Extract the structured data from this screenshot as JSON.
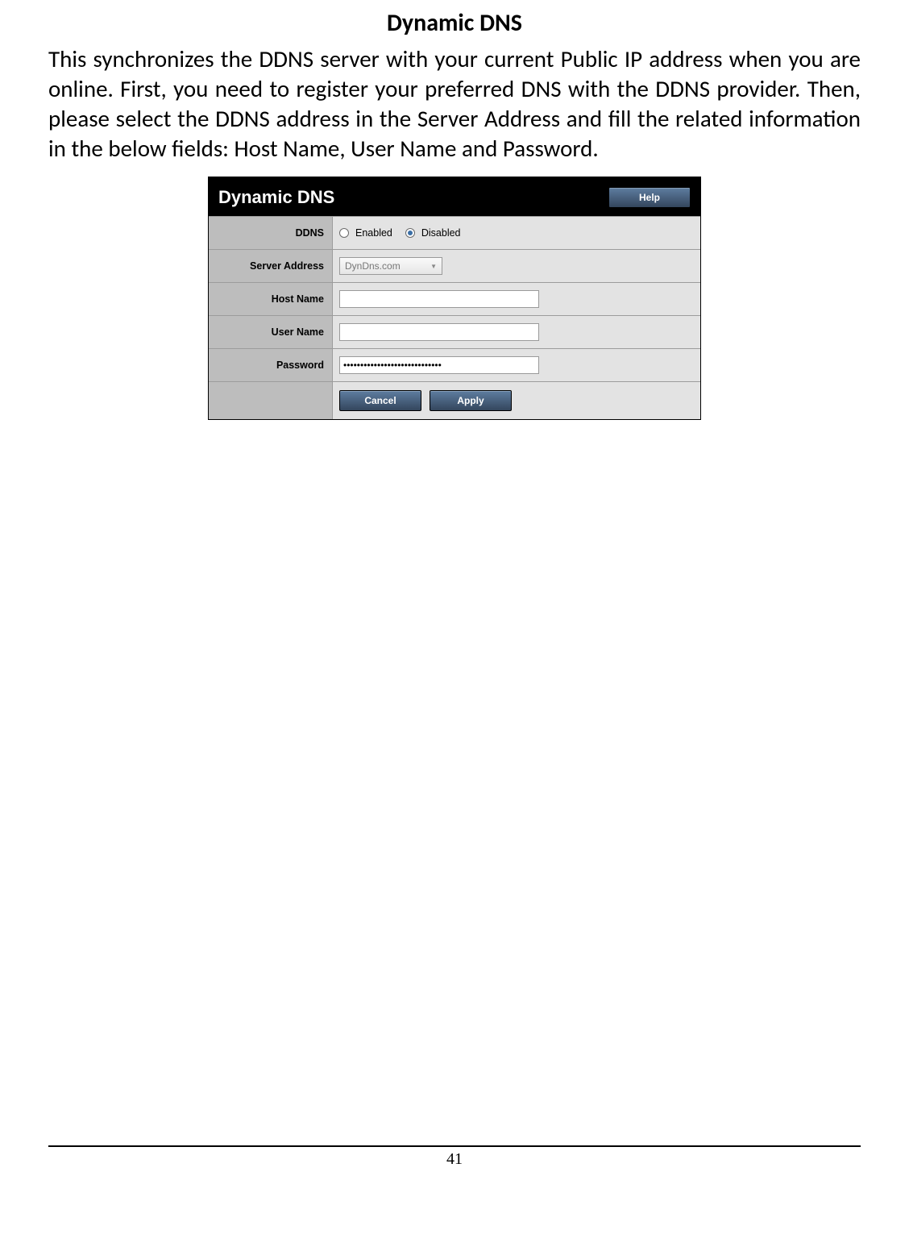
{
  "doc": {
    "title": "Dynamic DNS",
    "body": "This synchronizes the DDNS server with your current Public IP address when you are online.  First, you need to register your preferred DNS with the DDNS provider.  Then, please select the DDNS address in the Server Address and fill the related information in the below fields: Host Name, User Name and Password."
  },
  "panel": {
    "title": "Dynamic DNS",
    "help_label": "Help",
    "rows": {
      "ddns": {
        "label": "DDNS",
        "enabled_label": "Enabled",
        "disabled_label": "Disabled",
        "selected": "disabled"
      },
      "server_address": {
        "label": "Server Address",
        "value": "DynDns.com"
      },
      "host_name": {
        "label": "Host Name",
        "value": ""
      },
      "user_name": {
        "label": "User Name",
        "value": ""
      },
      "password": {
        "label": "Password",
        "value": "•••••••••••••••••••••••••••••"
      }
    },
    "cancel_label": "Cancel",
    "apply_label": "Apply"
  },
  "page_number": "41"
}
